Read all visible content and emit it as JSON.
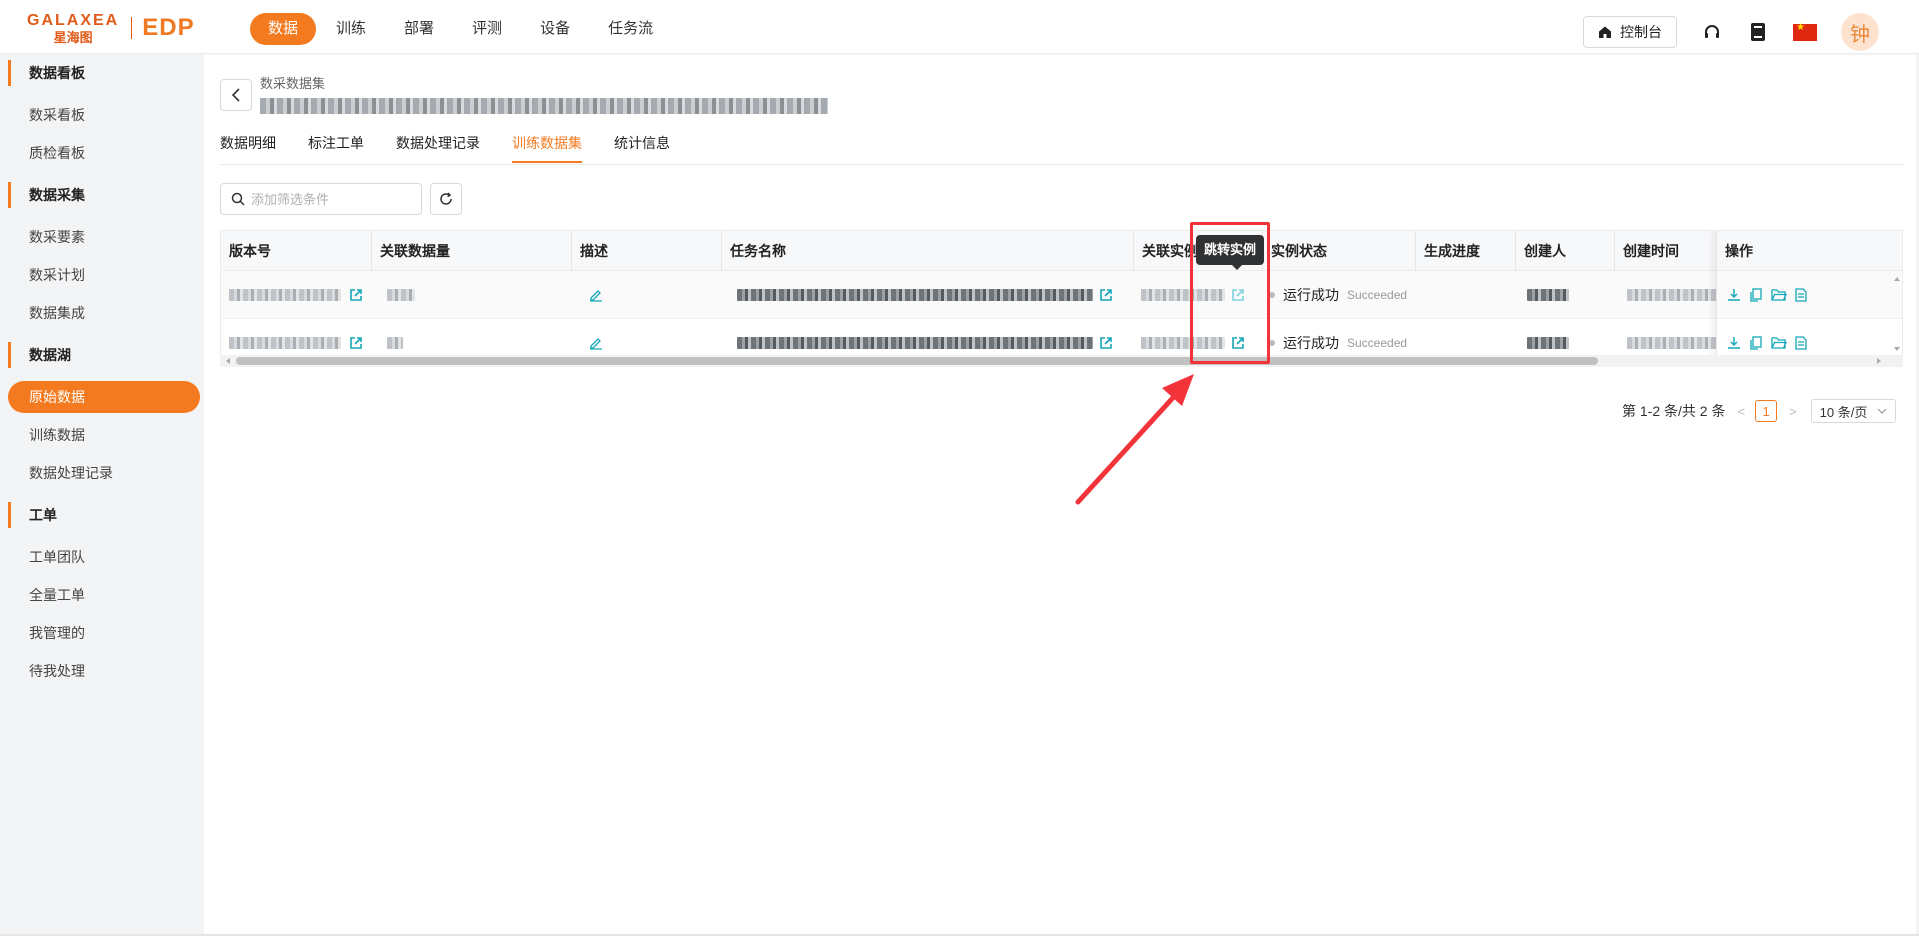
{
  "brand": {
    "logo_en": "GALAXEA",
    "logo_cn": "星海图",
    "product": "EDP",
    "accent_color": "#f47a20"
  },
  "topnav": {
    "items": [
      {
        "label": "数据",
        "active": true
      },
      {
        "label": "训练",
        "active": false
      },
      {
        "label": "部署",
        "active": false
      },
      {
        "label": "评测",
        "active": false
      },
      {
        "label": "设备",
        "active": false
      },
      {
        "label": "任务流",
        "active": false
      }
    ],
    "console_label": "控制台",
    "avatar_char": "钟"
  },
  "sidebar": {
    "groups": [
      {
        "label": "数据看板",
        "items": [
          "数采看板",
          "质检看板"
        ]
      },
      {
        "label": "数据采集",
        "items": [
          "数采要素",
          "数采计划",
          "数据集成"
        ]
      },
      {
        "label": "数据湖",
        "items": [
          "原始数据",
          "训练数据",
          "数据处理记录"
        ]
      },
      {
        "label": "工单",
        "items": [
          "工单团队",
          "全量工单",
          "我管理的",
          "待我处理"
        ]
      }
    ],
    "active_item": "原始数据"
  },
  "page": {
    "parent_crumb": "数采数据集",
    "tabs": [
      "数据明细",
      "标注工单",
      "数据处理记录",
      "训练数据集",
      "统计信息"
    ],
    "active_tab": "训练数据集",
    "filter_placeholder": "添加筛选条件"
  },
  "table": {
    "columns": [
      "版本号",
      "关联数据量",
      "描述",
      "任务名称",
      "关联实例",
      "实例状态",
      "生成进度",
      "创建人",
      "创建时间",
      "操作"
    ],
    "rows": [
      {
        "status": "运行成功",
        "status_en": "Succeeded"
      },
      {
        "status": "运行成功",
        "status_en": "Succeeded"
      }
    ]
  },
  "tooltip": "跳转实例",
  "pagination": {
    "summary": "第 1-2 条/共 2 条",
    "current_page": "1",
    "page_size": "10 条/页"
  }
}
